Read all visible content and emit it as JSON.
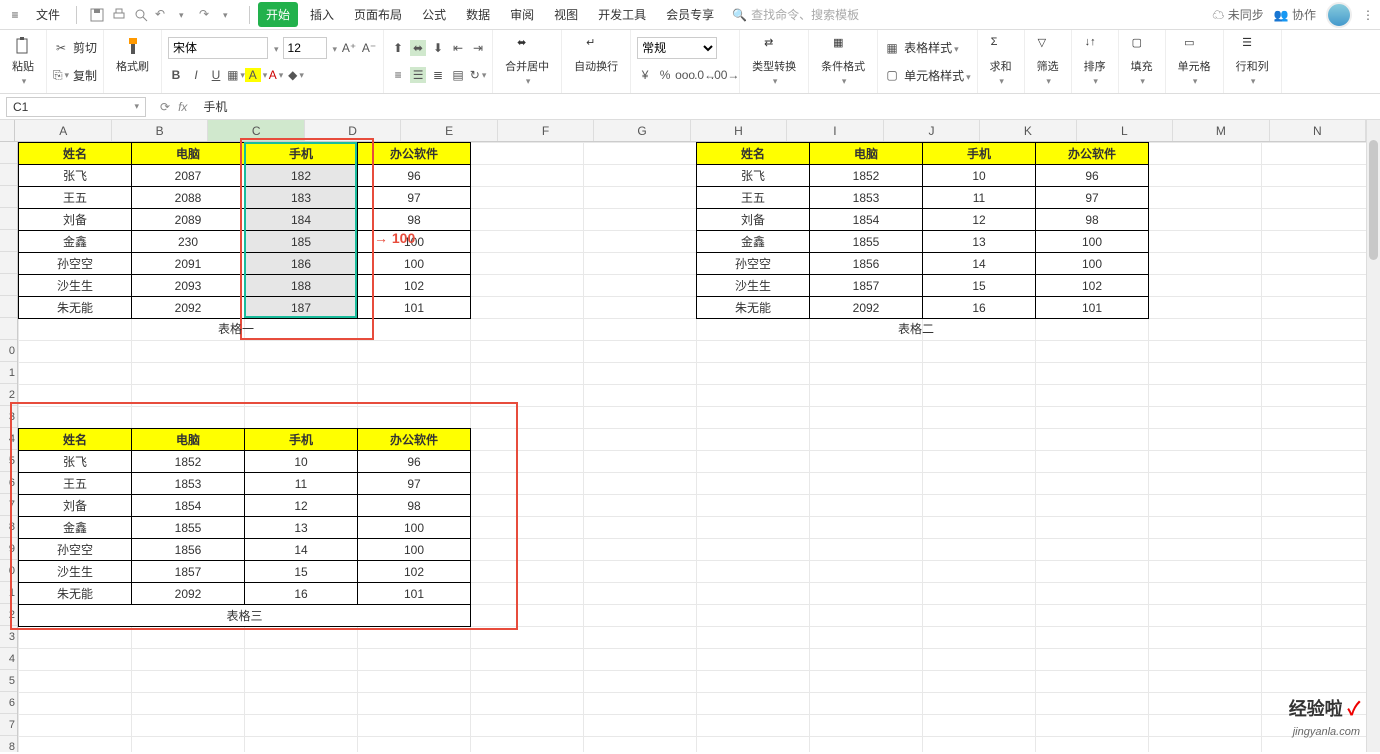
{
  "menubar": {
    "file": "文件",
    "items": [
      "开始",
      "插入",
      "页面布局",
      "公式",
      "数据",
      "审阅",
      "视图",
      "开发工具",
      "会员专享"
    ],
    "search_placeholder": "查找命令、搜索模板",
    "unsync": "未同步",
    "collab": "协作"
  },
  "ribbon": {
    "cut": "剪切",
    "copy": "复制",
    "paste": "粘贴",
    "fmtpaint": "格式刷",
    "font_name": "宋体",
    "font_size": "12",
    "merge": "合并居中",
    "wrap": "自动换行",
    "numfmt": "常规",
    "typeconv": "类型转换",
    "condfmt": "条件格式",
    "tblstyle": "表格样式",
    "cellstyle": "单元格样式",
    "sum": "求和",
    "filter": "筛选",
    "sort": "排序",
    "fill": "填充",
    "cellgrp": "单元格",
    "rowcol": "行和列"
  },
  "namebox": "C1",
  "formula_value": "手机",
  "columns": [
    "A",
    "B",
    "C",
    "D",
    "E",
    "F",
    "G",
    "H",
    "I",
    "J",
    "K",
    "L",
    "M",
    "N"
  ],
  "headers": {
    "name": "姓名",
    "pc": "电脑",
    "phone": "手机",
    "office": "办公软件"
  },
  "table1_rows": [
    {
      "name": "张飞",
      "pc": "2087",
      "phone": "182",
      "office": "96"
    },
    {
      "name": "王五",
      "pc": "2088",
      "phone": "183",
      "office": "97"
    },
    {
      "name": "刘备",
      "pc": "2089",
      "phone": "184",
      "office": "98"
    },
    {
      "name": "金鑫",
      "pc": "230",
      "phone": "185",
      "office": "100"
    },
    {
      "name": "孙空空",
      "pc": "2091",
      "phone": "186",
      "office": "100"
    },
    {
      "name": "沙生生",
      "pc": "2093",
      "phone": "188",
      "office": "102"
    },
    {
      "name": "朱无能",
      "pc": "2092",
      "phone": "187",
      "office": "101"
    }
  ],
  "table2_rows": [
    {
      "name": "张飞",
      "pc": "1852",
      "phone": "10",
      "office": "96"
    },
    {
      "name": "王五",
      "pc": "1853",
      "phone": "11",
      "office": "97"
    },
    {
      "name": "刘备",
      "pc": "1854",
      "phone": "12",
      "office": "98"
    },
    {
      "name": "金鑫",
      "pc": "1855",
      "phone": "13",
      "office": "100"
    },
    {
      "name": "孙空空",
      "pc": "1856",
      "phone": "14",
      "office": "100"
    },
    {
      "name": "沙生生",
      "pc": "1857",
      "phone": "15",
      "office": "102"
    },
    {
      "name": "朱无能",
      "pc": "2092",
      "phone": "16",
      "office": "101"
    }
  ],
  "table3_rows": [
    {
      "name": "张飞",
      "pc": "1852",
      "phone": "10",
      "office": "96"
    },
    {
      "name": "王五",
      "pc": "1853",
      "phone": "11",
      "office": "97"
    },
    {
      "name": "刘备",
      "pc": "1854",
      "phone": "12",
      "office": "98"
    },
    {
      "name": "金鑫",
      "pc": "1855",
      "phone": "13",
      "office": "100"
    },
    {
      "name": "孙空空",
      "pc": "1856",
      "phone": "14",
      "office": "100"
    },
    {
      "name": "沙生生",
      "pc": "1857",
      "phone": "15",
      "office": "102"
    },
    {
      "name": "朱无能",
      "pc": "2092",
      "phone": "16",
      "office": "101"
    }
  ],
  "labels": {
    "t1": "表格一",
    "t2": "表格二",
    "t3": "表格三"
  },
  "arrow_value": "100",
  "watermark": {
    "main": "经验啦",
    "check": "✓",
    "sub": "jingyanla.com"
  }
}
